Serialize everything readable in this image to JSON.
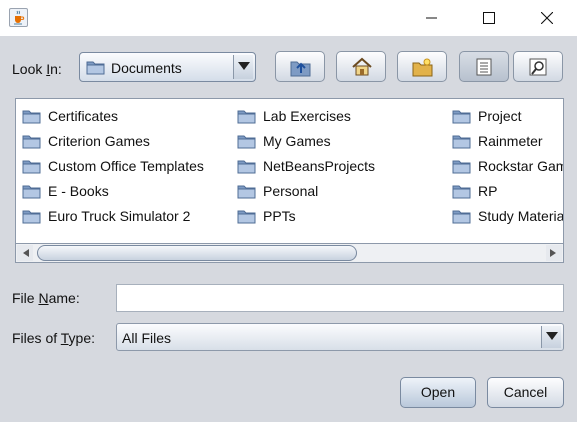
{
  "window": {
    "app_icon": "java-cup-icon",
    "controls": [
      "minimize-icon",
      "maximize-icon",
      "close-icon"
    ]
  },
  "look_in": {
    "label_prefix": "Look ",
    "label_mnemonic": "I",
    "label_suffix": "n:",
    "value": "Documents",
    "folder_icon": "folder-icon"
  },
  "toolbar": {
    "buttons": [
      "up-one-level-icon",
      "home-icon",
      "new-folder-icon",
      "list-view-icon",
      "details-view-icon"
    ]
  },
  "files": [
    {
      "name": "Certificates"
    },
    {
      "name": "Criterion Games"
    },
    {
      "name": "Custom Office Templates"
    },
    {
      "name": "E - Books"
    },
    {
      "name": "Euro Truck Simulator 2"
    },
    {
      "name": "Lab Exercises"
    },
    {
      "name": "My Games"
    },
    {
      "name": "NetBeansProjects"
    },
    {
      "name": "Personal"
    },
    {
      "name": "PPTs"
    },
    {
      "name": "Project"
    },
    {
      "name": "Rainmeter"
    },
    {
      "name": "Rockstar Games"
    },
    {
      "name": "RP"
    },
    {
      "name": "Study Material"
    }
  ],
  "file_name": {
    "label_prefix": "File ",
    "label_mnemonic": "N",
    "label_suffix": "ame:",
    "value": ""
  },
  "file_type": {
    "label_prefix": "Files of ",
    "label_mnemonic": "T",
    "label_suffix": "ype:",
    "value": "All Files"
  },
  "buttons": {
    "open": "Open",
    "cancel": "Cancel"
  }
}
